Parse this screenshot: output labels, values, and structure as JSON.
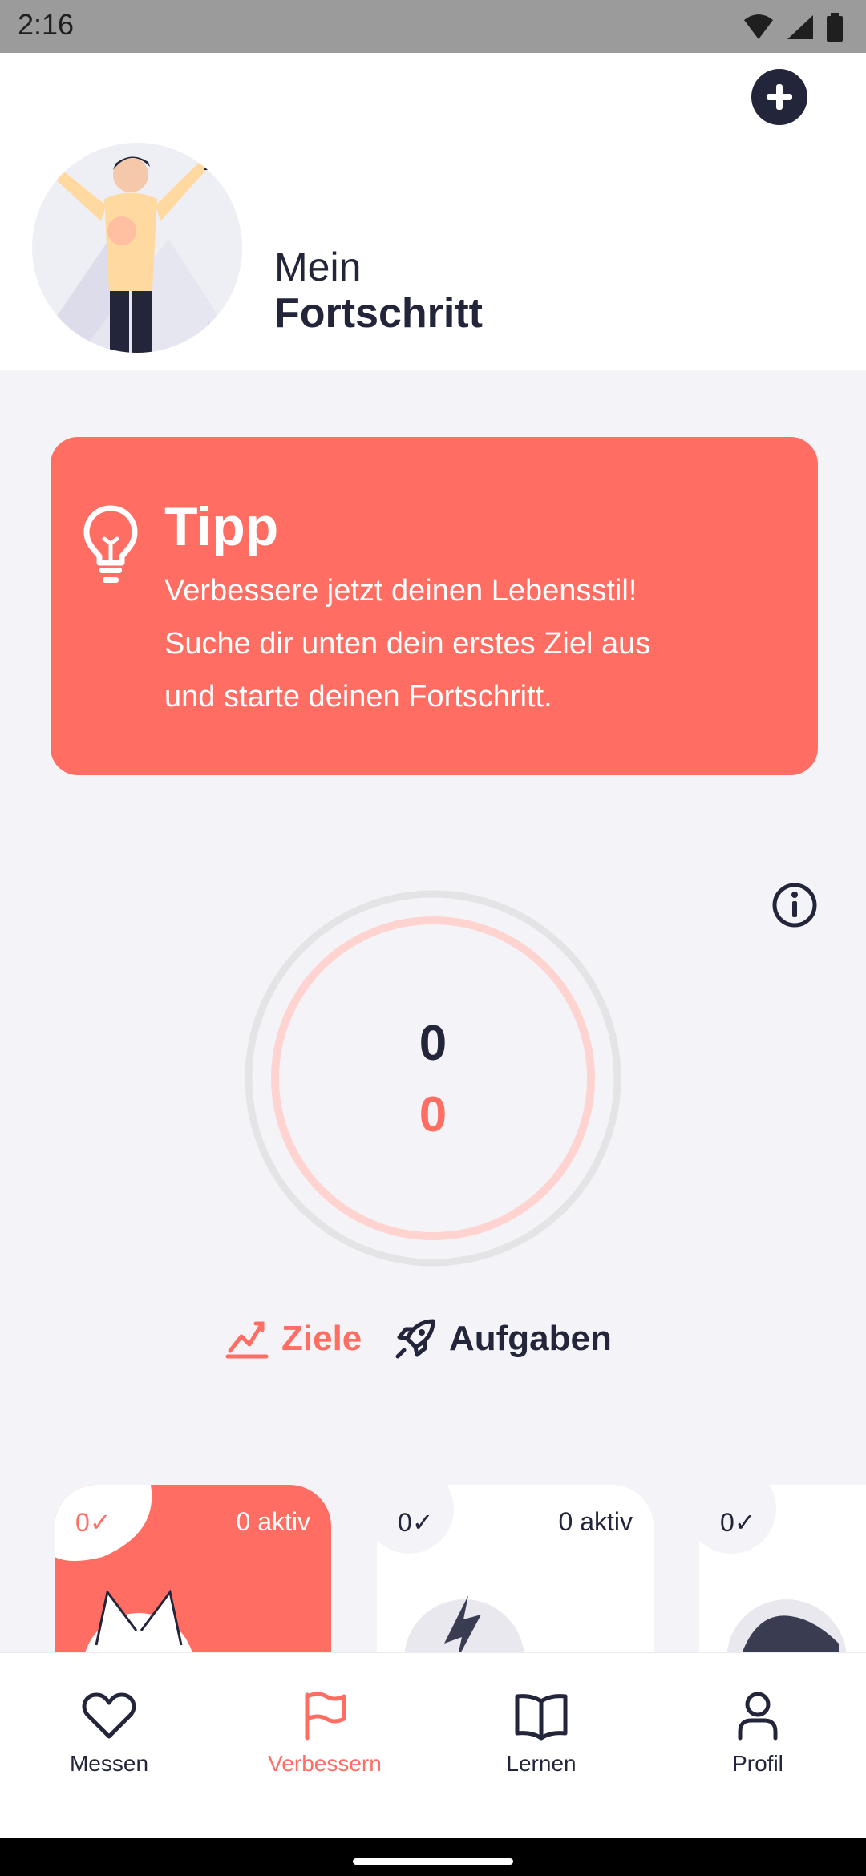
{
  "status": {
    "time": "2:16"
  },
  "header": {
    "title_light": "Mein",
    "title_bold": "Fortschritt"
  },
  "tip": {
    "title": "Tipp",
    "lines": [
      "Verbessere jetzt deinen Lebensstil!",
      "Suche dir unten dein erstes Ziel aus",
      "und starte deinen Fortschritt."
    ]
  },
  "progress": {
    "top_value": "0",
    "bottom_value": "0"
  },
  "tabs": [
    {
      "label": "Ziele",
      "icon": "mountain-chart-icon",
      "selected": true
    },
    {
      "label": "Aufgaben",
      "icon": "rocket-icon",
      "selected": false
    }
  ],
  "cards": [
    {
      "count": "0✓",
      "active": "0 aktiv",
      "icon": "fox-icon"
    },
    {
      "count": "0✓",
      "active": "0 aktiv",
      "icon": "lightning-icon"
    },
    {
      "count": "0✓",
      "active": "",
      "icon": "shoe-icon"
    }
  ],
  "nav": [
    {
      "label": "Messen",
      "icon": "heart-icon",
      "selected": false
    },
    {
      "label": "Verbessern",
      "icon": "flag-icon",
      "selected": true
    },
    {
      "label": "Lernen",
      "icon": "book-icon",
      "selected": false
    },
    {
      "label": "Profil",
      "icon": "person-icon",
      "selected": false
    }
  ],
  "colors": {
    "accent": "#ff6d63",
    "dark": "#23263a",
    "background": "#f4f4f8"
  }
}
